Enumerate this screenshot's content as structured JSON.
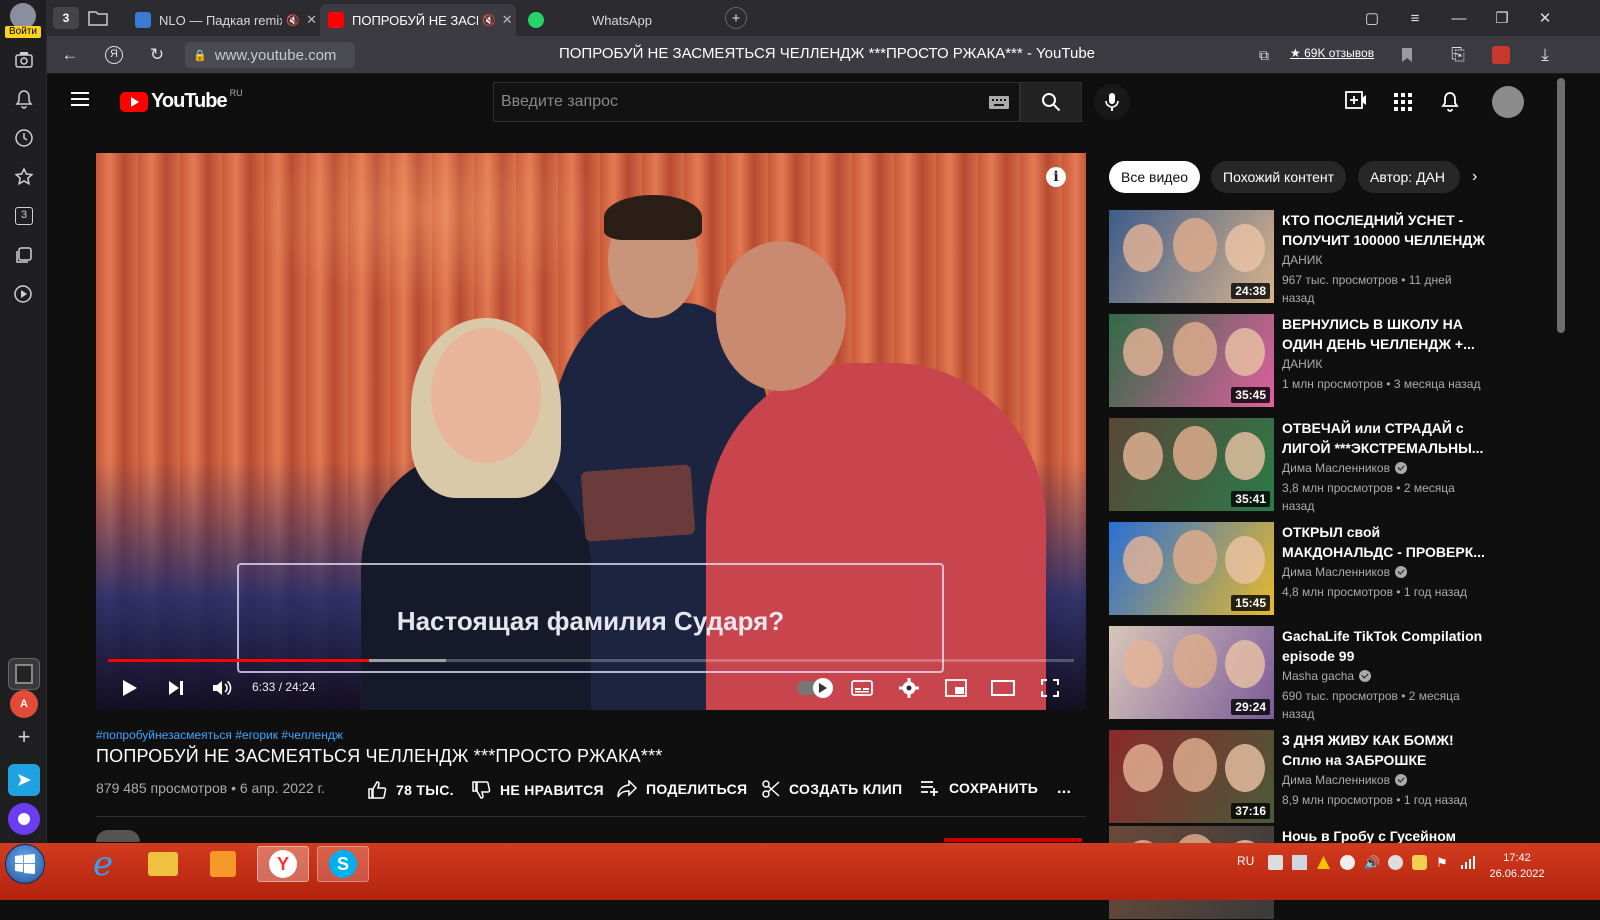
{
  "rail": {
    "login_label": "Войти",
    "tab_count": "3"
  },
  "tabs": [
    {
      "title": "NLO — Падкая remix",
      "color": "#3a7bd5"
    },
    {
      "title": "ПОПРОБУЙ НЕ ЗАСМЕЯТЬСЯ",
      "color": "#ff0000"
    },
    {
      "title": "WhatsApp",
      "color": "#25d366"
    }
  ],
  "tab_counter": "3",
  "address": {
    "url": "www.youtube.com",
    "page_title": "ПОПРОБУЙ НЕ ЗАСМЕЯТЬСЯ ЧЕЛЛЕНДЖ ***ПРОСТО РЖАКА*** - YouTube",
    "reviews": "★ 69K отзывов"
  },
  "yt": {
    "logo": "YouTube",
    "region": "RU",
    "search_placeholder": "Введите запрос"
  },
  "player": {
    "subtitle": "Настоящая фамилия Сударя?",
    "time": "6:33 / 24:24",
    "progress_played": 0.27,
    "progress_buffered": 0.35
  },
  "video": {
    "tags": "#попробуйнезасмеяться #егорик #челлендж",
    "title": "ПОПРОБУЙ НЕ ЗАСМЕЯТЬСЯ ЧЕЛЛЕНДЖ ***ПРОСТО РЖАКА***",
    "meta": "879 485 просмотров • 6 апр. 2022 г.",
    "likes": "78 ТЫС.",
    "dislike": "НЕ НРАВИТСЯ",
    "share": "ПОДЕЛИТЬСЯ",
    "clip": "СОЗДАТЬ КЛИП",
    "save": "СОХРАНИТЬ",
    "more": "..."
  },
  "chips": [
    "Все видео",
    "Похожий контент",
    "Автор: ДАН"
  ],
  "recs": [
    {
      "title": "КТО ПОСЛЕДНИЙ УСНЕТ - ПОЛУЧИТ 100000 ЧЕЛЛЕНДЖ",
      "channel": "ДАНИК",
      "verified": false,
      "stats": "967 тыс. просмотров • 11 дней назад",
      "duration": "24:38",
      "c1": "#3d5c8a",
      "c2": "#d9b38c"
    },
    {
      "title": "ВЕРНУЛИСЬ В ШКОЛУ НА ОДИН ДЕНЬ ЧЕЛЛЕНДЖ +...",
      "channel": "ДАНИК",
      "verified": false,
      "stats": "1 млн просмотров • 3 месяца назад",
      "duration": "35:45",
      "c1": "#2f6b45",
      "c2": "#e05fa0"
    },
    {
      "title": "ОТВЕЧАЙ или СТРАДАЙ с ЛИГОЙ ***ЭКСТРЕМАЛЬНЫ...",
      "channel": "Дима Масленников",
      "verified": true,
      "stats": "3,8 млн просмотров • 2 месяца назад",
      "duration": "35:41",
      "c1": "#5a4636",
      "c2": "#2b7a4a"
    },
    {
      "title": "ОТКРЫЛ свой МАКДОНАЛЬДС - ПРОВЕРК...",
      "channel": "Дима Масленников",
      "verified": true,
      "stats": "4,8 млн просмотров • 1 год назад",
      "duration": "15:45",
      "c1": "#2a6fd6",
      "c2": "#e8b92a"
    },
    {
      "title": "GachaLife TikTok Compilation episode 99",
      "channel": "Masha gacha",
      "verified": true,
      "stats": "690 тыс. просмотров • 2 месяца назад",
      "duration": "29:24",
      "c1": "#d9c7b8",
      "c2": "#7a5a9a"
    },
    {
      "title": "3 ДНЯ ЖИВУ КАК БОМЖ! Сплю на ЗАБРОШКЕ",
      "channel": "Дима Масленников",
      "verified": true,
      "stats": "8,9 млн просмотров • 1 год назад",
      "duration": "37:16",
      "c1": "#8a2a2a",
      "c2": "#4a5a3a"
    },
    {
      "title": "Ночь в Гробу с Гусейном",
      "channel": "",
      "verified": false,
      "stats": "",
      "duration": "",
      "c1": "#6a4a3a",
      "c2": "#3a3a3a"
    }
  ],
  "taskbar": {
    "lang": "RU",
    "time": "17:42",
    "date": "26.06.2022"
  }
}
